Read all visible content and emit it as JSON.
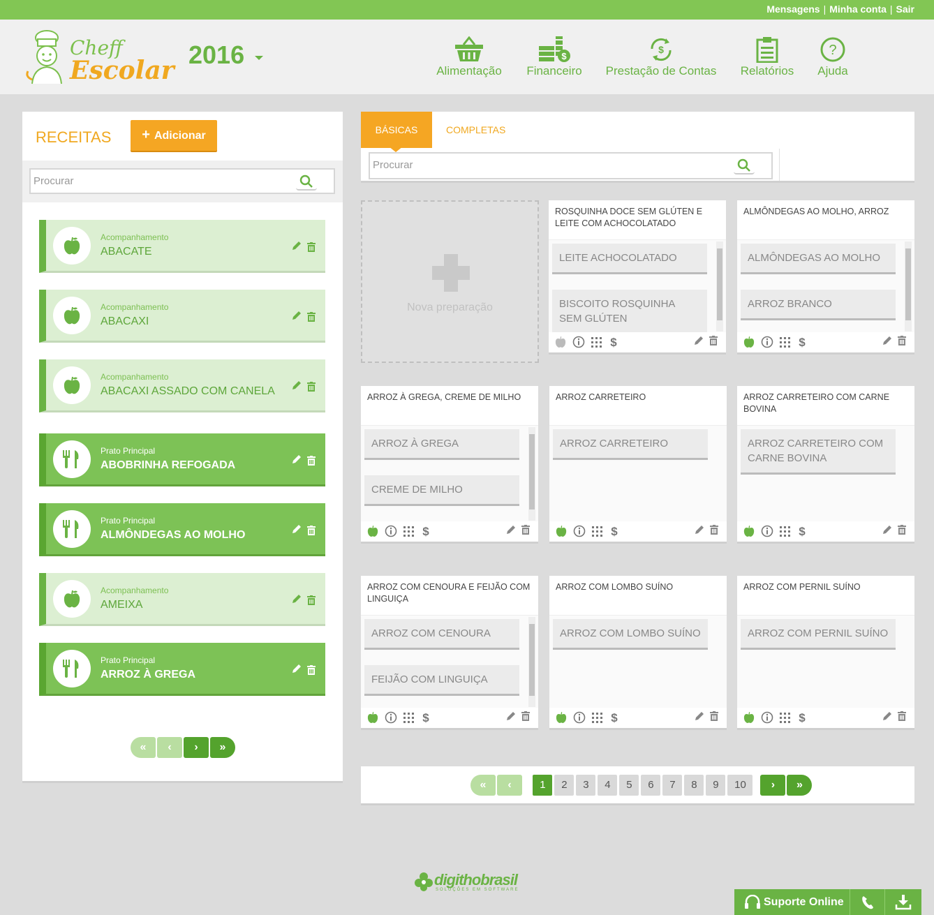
{
  "toplinks": {
    "messages": "Mensagens",
    "account": "Minha conta",
    "logout": "Sair",
    "separator": "|"
  },
  "header": {
    "logo_top": "Cheff",
    "logo_bottom": "Escolar",
    "year": "2016",
    "nav": [
      {
        "label": "Alimentação",
        "icon": "basket-icon"
      },
      {
        "label": "Financeiro",
        "icon": "coins-icon"
      },
      {
        "label": "Prestação de Contas",
        "icon": "money-cycle-icon"
      },
      {
        "label": "Relatórios",
        "icon": "clipboard-icon"
      },
      {
        "label": "Ajuda",
        "icon": "help-icon"
      }
    ]
  },
  "receitas": {
    "title": "RECEITAS",
    "add_label": "Adicionar",
    "search_placeholder": "Procurar",
    "items": [
      {
        "category": "Acompanhamento",
        "name": "ABACATE",
        "style": "light",
        "icon": "apple-icon"
      },
      {
        "category": "Acompanhamento",
        "name": "ABACAXI",
        "style": "light",
        "icon": "apple-icon"
      },
      {
        "category": "Acompanhamento",
        "name": "ABACAXI ASSADO COM CANELA",
        "style": "light",
        "icon": "apple-icon"
      },
      {
        "category": "Prato Principal",
        "name": "ABOBRINHA REFOGADA",
        "style": "dark",
        "icon": "cutlery-icon"
      },
      {
        "category": "Prato Principal",
        "name": "ALMÔNDEGAS AO MOLHO",
        "style": "dark",
        "icon": "cutlery-icon"
      },
      {
        "category": "Acompanhamento",
        "name": "AMEIXA",
        "style": "light",
        "icon": "apple-icon"
      },
      {
        "category": "Prato Principal",
        "name": "ARROZ À GREGA",
        "style": "dark",
        "icon": "cutlery-icon"
      }
    ]
  },
  "tabs": {
    "basic": "BÁSICAS",
    "complete": "COMPLETAS",
    "search_placeholder": "Procurar"
  },
  "new_prep_label": "Nova preparação",
  "preparations": [
    {
      "title": "ROSQUINHA DOCE SEM GLÚTEN E LEITE COM ACHOCOLATADO",
      "items": [
        "LEITE ACHOCOLATADO",
        "BISCOITO ROSQUINHA SEM GLÚTEN"
      ],
      "apple_color": "gray"
    },
    {
      "title": "ALMÔNDEGAS AO MOLHO, ARROZ",
      "items": [
        "ALMÔNDEGAS AO MOLHO",
        "ARROZ BRANCO"
      ],
      "apple_color": "green"
    },
    {
      "title": "ARROZ À GREGA, CREME DE MILHO",
      "items": [
        "ARROZ À GREGA",
        "CREME DE MILHO"
      ],
      "apple_color": "green"
    },
    {
      "title": "ARROZ CARRETEIRO",
      "items": [
        "ARROZ CARRETEIRO"
      ],
      "apple_color": "green"
    },
    {
      "title": "ARROZ CARRETEIRO COM CARNE BOVINA",
      "items": [
        "ARROZ CARRETEIRO COM CARNE BOVINA"
      ],
      "apple_color": "green"
    },
    {
      "title": "ARROZ COM CENOURA E FEIJÃO COM LINGUIÇA",
      "items": [
        "ARROZ COM CENOURA",
        "FEIJÃO COM LINGUIÇA"
      ],
      "apple_color": "green"
    },
    {
      "title": "ARROZ COM LOMBO SUÍNO",
      "items": [
        "ARROZ COM LOMBO SUÍNO"
      ],
      "apple_color": "green"
    },
    {
      "title": "ARROZ COM PERNIL SUÍNO",
      "items": [
        "ARROZ COM PERNIL SUÍNO"
      ],
      "apple_color": "green"
    }
  ],
  "pagination": {
    "pages": [
      "1",
      "2",
      "3",
      "4",
      "5",
      "6",
      "7",
      "8",
      "9",
      "10"
    ],
    "current": "1"
  },
  "footer": {
    "brand": "digithobrasil",
    "tagline": "SOLUÇÕES EM SOFTWARE",
    "support_label": "Suporte Online"
  },
  "colors": {
    "green": "#6ab344",
    "orange": "#f5a623",
    "light_green": "#dcefd2"
  }
}
